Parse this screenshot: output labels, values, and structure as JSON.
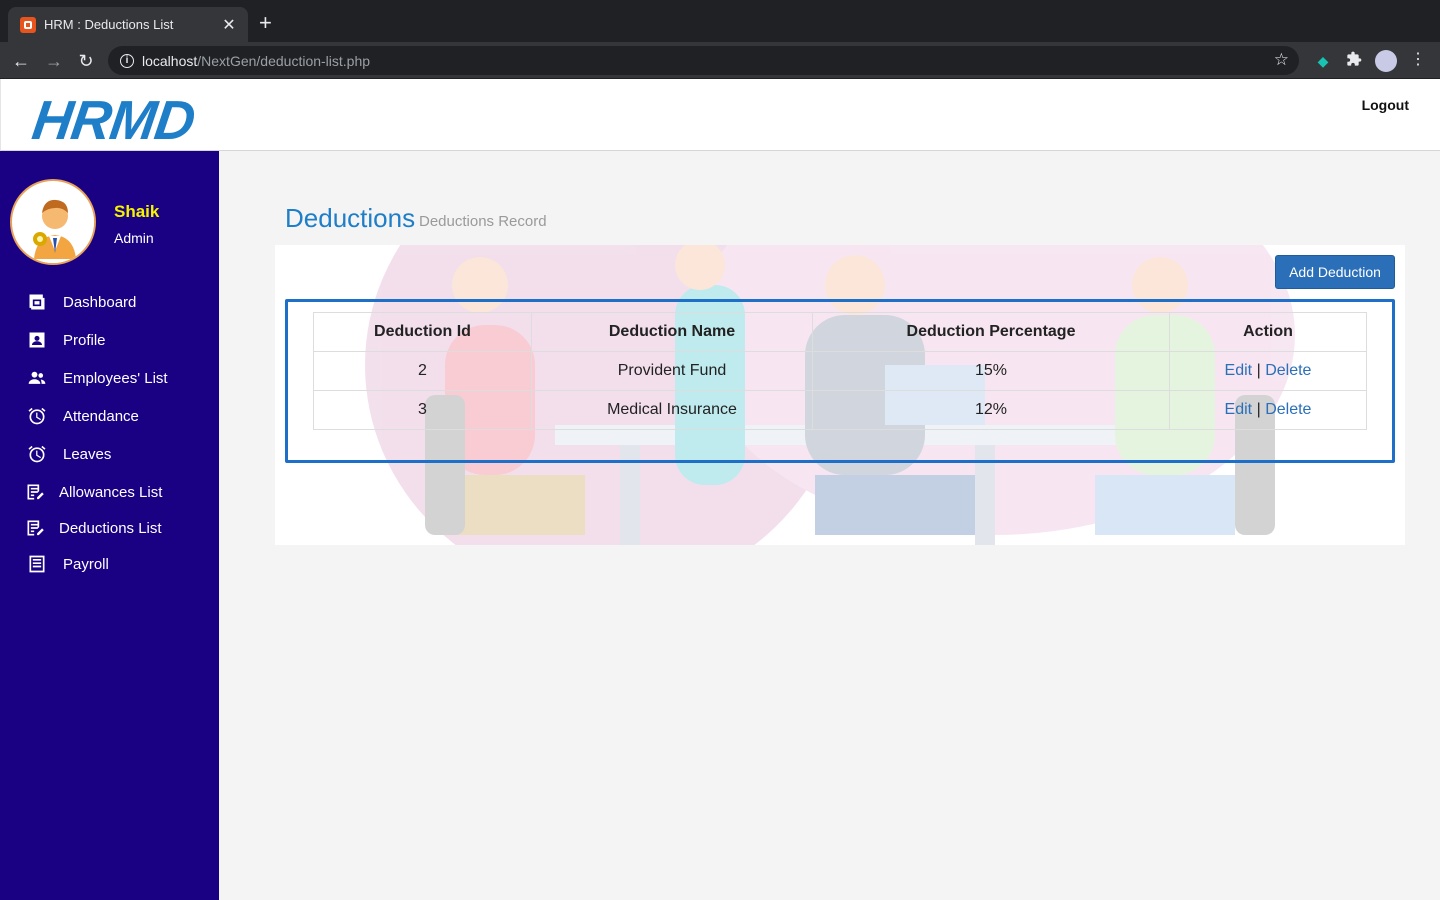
{
  "browser": {
    "tab_title": "HRM : Deductions List",
    "url_host": "localhost",
    "url_path": "/NextGen/deduction-list.php"
  },
  "header": {
    "logo": "HRMD",
    "logout": "Logout"
  },
  "user": {
    "name": "Shaik",
    "role": "Admin"
  },
  "sidebar": {
    "items": [
      {
        "label": "Dashboard",
        "icon": "dashboard-icon"
      },
      {
        "label": "Profile",
        "icon": "profile-icon"
      },
      {
        "label": "Employees' List",
        "icon": "people-icon"
      },
      {
        "label": "Attendance",
        "icon": "alarm-icon"
      },
      {
        "label": "Leaves",
        "icon": "alarm-icon"
      },
      {
        "label": "Allowances List",
        "icon": "list-edit-icon"
      },
      {
        "label": "Deductions List",
        "icon": "list-edit-icon"
      },
      {
        "label": "Payroll",
        "icon": "receipt-icon"
      }
    ]
  },
  "main": {
    "title": "Deductions",
    "subtitle": "Deductions Record",
    "add_button": "Add Deduction",
    "table": {
      "headers": [
        "Deduction Id",
        "Deduction Name",
        "Deduction Percentage",
        "Action"
      ],
      "rows": [
        {
          "id": "2",
          "name": "Provident Fund",
          "percentage": "15%",
          "edit": "Edit",
          "sep": "|",
          "delete": "Delete"
        },
        {
          "id": "3",
          "name": "Medical Insurance",
          "percentage": "12%",
          "edit": "Edit",
          "sep": "|",
          "delete": "Delete"
        }
      ]
    }
  },
  "colors": {
    "sidebar": "#1a0082",
    "accent": "#1e7ec8",
    "button": "#2a6fb8",
    "username": "#f5f500"
  }
}
